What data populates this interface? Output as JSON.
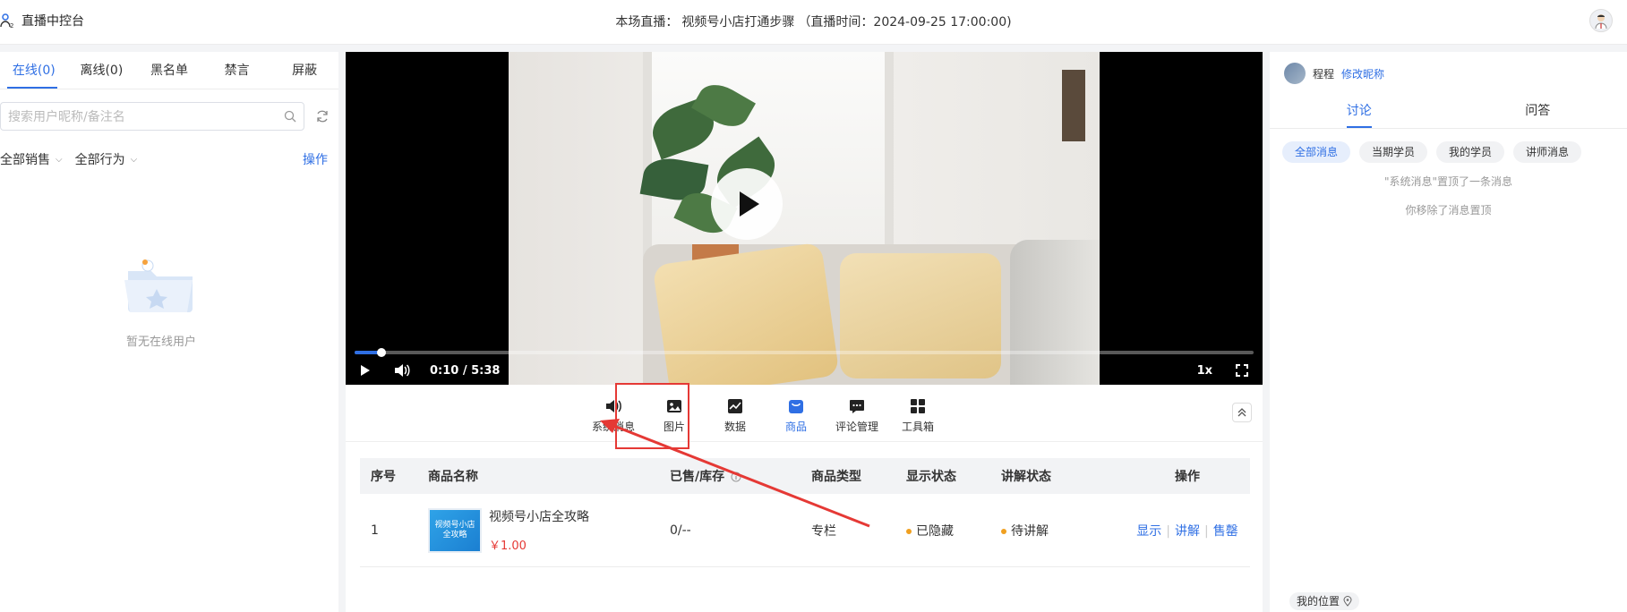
{
  "header": {
    "app_title": "直播中控台",
    "live_prefix": "本场直播：",
    "live_name": "视频号小店打通步骤",
    "live_time": "（直播时间：2024-09-25 17:00:00)"
  },
  "left": {
    "tabs": [
      {
        "label": "在线(0)",
        "active": true
      },
      {
        "label": "离线(0)",
        "active": false
      },
      {
        "label": "黑名单",
        "active": false
      },
      {
        "label": "禁言",
        "active": false
      },
      {
        "label": "屏蔽",
        "active": false
      }
    ],
    "search_placeholder": "搜索用户昵称/备注名",
    "filters": [
      "全部销售",
      "全部行为"
    ],
    "operation_label": "操作",
    "empty_text": "暂无在线用户"
  },
  "player": {
    "time": "0:10 / 5:38",
    "speed": "1x",
    "progress": 0.03
  },
  "toolbar": {
    "tools": [
      {
        "label": "系统消息",
        "icon": "speaker-icon"
      },
      {
        "label": "图片",
        "icon": "image-icon"
      },
      {
        "label": "数据",
        "icon": "chart-icon"
      },
      {
        "label": "商品",
        "icon": "shop-icon",
        "active": true
      },
      {
        "label": "评论管理",
        "icon": "comment-icon"
      },
      {
        "label": "工具箱",
        "icon": "toolbox-icon"
      }
    ]
  },
  "table": {
    "headers": [
      "序号",
      "商品名称",
      "已售/库存",
      "商品类型",
      "显示状态",
      "讲解状态",
      "操作"
    ],
    "rows": [
      {
        "index": "1",
        "name": "视频号小店全攻略",
        "thumb_text": "视频号小店 全攻略",
        "price": "￥1.00",
        "sold_stock": "0/--",
        "type": "专栏",
        "display_status": "已隐藏",
        "explain_status": "待讲解",
        "actions": [
          "显示",
          "讲解",
          "售罄"
        ]
      }
    ]
  },
  "right": {
    "username": "程程",
    "edit_nickname": "修改昵称",
    "tabs": [
      {
        "label": "讨论",
        "active": true
      },
      {
        "label": "问答",
        "active": false
      }
    ],
    "chips": [
      {
        "label": "全部消息",
        "active": true
      },
      {
        "label": "当期学员",
        "active": false
      },
      {
        "label": "我的学员",
        "active": false
      },
      {
        "label": "讲师消息",
        "active": false
      }
    ],
    "notices": [
      "\"系统消息\"置顶了一条消息",
      "你移除了消息置顶"
    ],
    "location": "我的位置"
  },
  "colors": {
    "accent": "#2f6fe4",
    "highlight": "#e53935",
    "status_dot": "#f0a020"
  }
}
